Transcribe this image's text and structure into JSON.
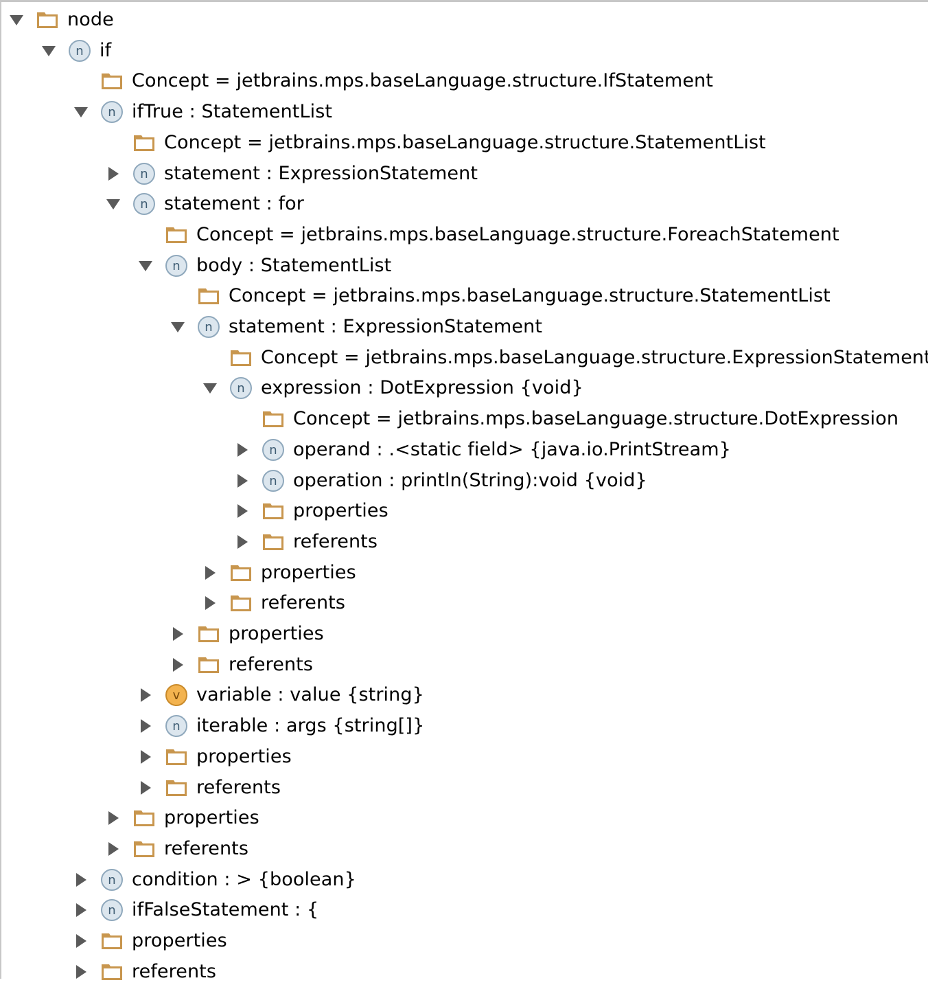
{
  "colors": {
    "folder": "#c8964e",
    "node_circle_fill": "#dce6ee",
    "node_circle_stroke": "#8fa8bc",
    "node_letter": "#3f5d74",
    "var_circle_fill": "#f3b34f",
    "var_circle_stroke": "#c98a2a",
    "var_letter": "#7a4a0a",
    "arrow": "#5a5a5a"
  },
  "tree": {
    "rows": [
      {
        "depth": 0,
        "toggle": "open",
        "icon": "folder-icon",
        "label": "node"
      },
      {
        "depth": 1,
        "toggle": "open",
        "icon": "node-icon",
        "icon_letter": "n",
        "label": "if"
      },
      {
        "depth": 2,
        "toggle": "none",
        "icon": "folder-icon",
        "label": "Concept = jetbrains.mps.baseLanguage.structure.IfStatement"
      },
      {
        "depth": 2,
        "toggle": "open",
        "icon": "node-icon",
        "icon_letter": "n",
        "label": "ifTrue : StatementList"
      },
      {
        "depth": 3,
        "toggle": "none",
        "icon": "folder-icon",
        "label": "Concept = jetbrains.mps.baseLanguage.structure.StatementList"
      },
      {
        "depth": 3,
        "toggle": "closed",
        "icon": "node-icon",
        "icon_letter": "n",
        "label": "statement : ExpressionStatement"
      },
      {
        "depth": 3,
        "toggle": "open",
        "icon": "node-icon",
        "icon_letter": "n",
        "label": "statement : for"
      },
      {
        "depth": 4,
        "toggle": "none",
        "icon": "folder-icon",
        "label": "Concept = jetbrains.mps.baseLanguage.structure.ForeachStatement"
      },
      {
        "depth": 4,
        "toggle": "open",
        "icon": "node-icon",
        "icon_letter": "n",
        "label": "body : StatementList"
      },
      {
        "depth": 5,
        "toggle": "none",
        "icon": "folder-icon",
        "label": "Concept = jetbrains.mps.baseLanguage.structure.StatementList"
      },
      {
        "depth": 5,
        "toggle": "open",
        "icon": "node-icon",
        "icon_letter": "n",
        "label": "statement : ExpressionStatement"
      },
      {
        "depth": 6,
        "toggle": "none",
        "icon": "folder-icon",
        "label": "Concept = jetbrains.mps.baseLanguage.structure.ExpressionStatement"
      },
      {
        "depth": 6,
        "toggle": "open",
        "icon": "node-icon",
        "icon_letter": "n",
        "label": "expression : DotExpression {void}"
      },
      {
        "depth": 7,
        "toggle": "none",
        "icon": "folder-icon",
        "label": "Concept = jetbrains.mps.baseLanguage.structure.DotExpression"
      },
      {
        "depth": 7,
        "toggle": "closed",
        "icon": "node-icon",
        "icon_letter": "n",
        "label": "operand : .<static field> {java.io.PrintStream}"
      },
      {
        "depth": 7,
        "toggle": "closed",
        "icon": "node-icon",
        "icon_letter": "n",
        "label": "operation : println(String):void {void}"
      },
      {
        "depth": 7,
        "toggle": "closed",
        "icon": "folder-icon",
        "label": "properties"
      },
      {
        "depth": 7,
        "toggle": "closed",
        "icon": "folder-icon",
        "label": "referents"
      },
      {
        "depth": 6,
        "toggle": "closed",
        "icon": "folder-icon",
        "label": "properties"
      },
      {
        "depth": 6,
        "toggle": "closed",
        "icon": "folder-icon",
        "label": "referents"
      },
      {
        "depth": 5,
        "toggle": "closed",
        "icon": "folder-icon",
        "label": "properties"
      },
      {
        "depth": 5,
        "toggle": "closed",
        "icon": "folder-icon",
        "label": "referents"
      },
      {
        "depth": 4,
        "toggle": "closed",
        "icon": "variable-icon",
        "icon_letter": "v",
        "label": "variable : value {string}"
      },
      {
        "depth": 4,
        "toggle": "closed",
        "icon": "node-icon",
        "icon_letter": "n",
        "label": "iterable : args {string[]}"
      },
      {
        "depth": 4,
        "toggle": "closed",
        "icon": "folder-icon",
        "label": "properties"
      },
      {
        "depth": 4,
        "toggle": "closed",
        "icon": "folder-icon",
        "label": "referents"
      },
      {
        "depth": 3,
        "toggle": "closed",
        "icon": "folder-icon",
        "label": "properties"
      },
      {
        "depth": 3,
        "toggle": "closed",
        "icon": "folder-icon",
        "label": "referents"
      },
      {
        "depth": 2,
        "toggle": "closed",
        "icon": "node-icon",
        "icon_letter": "n",
        "label": "condition : > {boolean}"
      },
      {
        "depth": 2,
        "toggle": "closed",
        "icon": "node-icon",
        "icon_letter": "n",
        "label": "ifFalseStatement : {"
      },
      {
        "depth": 2,
        "toggle": "closed",
        "icon": "folder-icon",
        "label": "properties"
      },
      {
        "depth": 2,
        "toggle": "closed",
        "icon": "folder-icon",
        "label": "referents"
      }
    ]
  }
}
